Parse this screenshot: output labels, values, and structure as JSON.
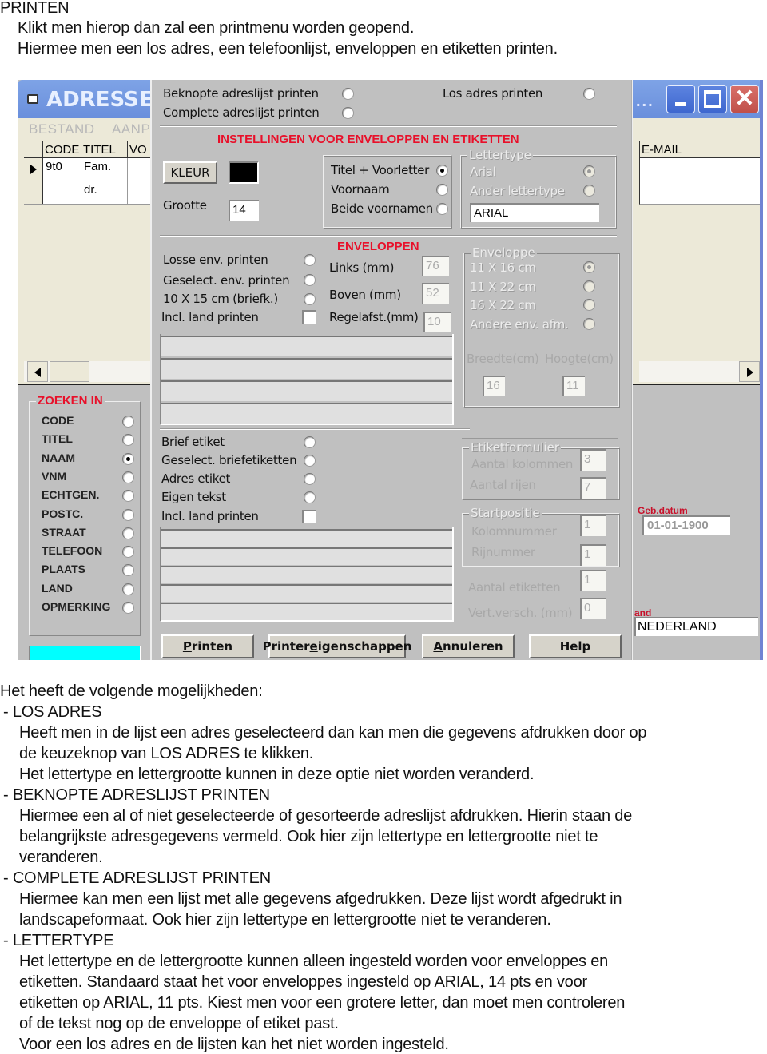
{
  "intro": {
    "heading": "PRINTEN",
    "lines": [
      "Klikt men hierop dan zal een printmenu worden geopend.",
      "Hiermee men een los adres, een telefoonlijst, enveloppen en etiketten printen."
    ]
  },
  "main_window": {
    "title": "ADRESSEN",
    "title_overflow": "...",
    "menu": [
      "BESTAND",
      "AANP"
    ],
    "grid": {
      "columns": [
        "CODE",
        "TITEL",
        "VO",
        "E-MAIL"
      ],
      "rows": [
        {
          "code": "9t0",
          "titel": "Fam.",
          "vo": "",
          "email": ""
        },
        {
          "code": "",
          "titel": "dr.",
          "vo": "",
          "email": ""
        }
      ]
    },
    "search": {
      "legend": "ZOEKEN IN",
      "options": [
        "CODE",
        "TITEL",
        "NAAM",
        "VNM",
        "ECHTGEN.",
        "POSTC.",
        "STRAAT",
        "TELEFOON",
        "PLAATS",
        "LAND",
        "OPMERKING"
      ],
      "selected": "NAAM",
      "input_value": ""
    },
    "fields": {
      "geb_label": "Geb.datum",
      "geb_value": "01-01-1900",
      "land_label": "and",
      "land_value": "NEDERLAND"
    }
  },
  "print_dialog": {
    "top_options": {
      "beknopt": "Beknopte adreslijst printen",
      "complete": "Complete adreslijst printen",
      "los": "Los adres printen"
    },
    "settings_heading": "INSTELLINGEN VOOR ENVELOPPEN EN ETIKETTEN",
    "kleur_button": "KLEUR",
    "color_value": "#000000",
    "grootte_label": "Grootte",
    "grootte_value": "14",
    "name_options": {
      "items": [
        "Titel + Voorletter",
        "Voornaam",
        "Beide voornamen"
      ],
      "selected": "Titel + Voorletter"
    },
    "lettertype": {
      "legend": "Lettertype",
      "items": [
        "Arial",
        "Ander lettertype"
      ],
      "selected": "Arial",
      "value": "ARIAL"
    },
    "enveloppen": {
      "heading": "ENVELOPPEN",
      "options": [
        "Losse env. printen",
        "Geselect. env. printen",
        "10 X 15 cm (briefk.)"
      ],
      "incl_land": "Incl. land printen",
      "links_label": "Links (mm)",
      "links_value": "76",
      "boven_label": "Boven (mm)",
      "boven_value": "52",
      "regel_label": "Regelafst.(mm)",
      "regel_value": "10"
    },
    "envelop_size": {
      "legend": "Enveloppe",
      "items": [
        "11 X 16 cm",
        "11 X 22 cm",
        "16 X 22 cm",
        "Andere env. afm."
      ],
      "selected": "11 X 16 cm",
      "breedte_label": "Breedte(cm)",
      "hoogte_label": "Hoogte(cm)",
      "breedte_value": "16",
      "hoogte_value": "11"
    },
    "etiketten": {
      "options": [
        "Brief etiket",
        "Geselect. briefetiketten",
        "Adres etiket",
        "Eigen tekst"
      ],
      "incl_land": "Incl. land printen"
    },
    "etiketformulier": {
      "legend": "Etiketformulier",
      "kolommen_label": "Aantal kolommen",
      "kolommen_value": "3",
      "rijen_label": "Aantal rijen",
      "rijen_value": "7"
    },
    "startpositie": {
      "legend": "Startpositie",
      "kolom_label": "Kolomnummer",
      "kolom_value": "1",
      "rij_label": "Rijnummer",
      "rij_value": "1"
    },
    "aantal_label": "Aantal etiketten",
    "aantal_value": "1",
    "vert_label": "Vert.versch. (mm)",
    "vert_value": "0",
    "buttons": {
      "printen": "Printen",
      "eigenschappen": "Printereigenschappen",
      "annuleren": "Annuleren",
      "help": "Help"
    }
  },
  "body_text": {
    "intro": "Het heeft de volgende mogelijkheden:",
    "sections": [
      {
        "title": "- LOS ADRES",
        "lines": [
          "Heeft men in de lijst een adres geselecteerd dan kan men die gegevens afdrukken door op",
          "de keuzeknop van LOS ADRES te klikken.",
          "Het lettertype en lettergrootte kunnen in deze optie niet worden veranderd."
        ]
      },
      {
        "title": "- BEKNOPTE ADRESLIJST PRINTEN",
        "lines": [
          "Hiermee een al of niet geselecteerde of gesorteerde adreslijst afdrukken. Hierin staan de",
          "belangrijkste adresgegevens vermeld. Ook hier zijn lettertype en lettergrootte niet te",
          "veranderen."
        ]
      },
      {
        "title": "- COMPLETE ADRESLIJST PRINTEN",
        "lines": [
          "Hiermee kan men een lijst met alle gegevens afgedrukken. Deze lijst wordt afgedrukt in",
          "landscapeformaat. Ook hier zijn lettertype en lettergrootte niet te veranderen."
        ]
      },
      {
        "title": "- LETTERTYPE",
        "lines": [
          "Het lettertype en de lettergrootte kunnen alleen ingesteld worden voor enveloppes en",
          "etiketten. Standaard staat het voor enveloppes ingesteld op ARIAL, 14 pts en voor",
          "etiketten op ARIAL, 11 pts. Kiest men voor een grotere letter, dan moet men controleren",
          "of de tekst nog op de enveloppe of etiket past.",
          "Voor een los adres en de lijsten kan het niet worden ingesteld."
        ]
      }
    ]
  }
}
